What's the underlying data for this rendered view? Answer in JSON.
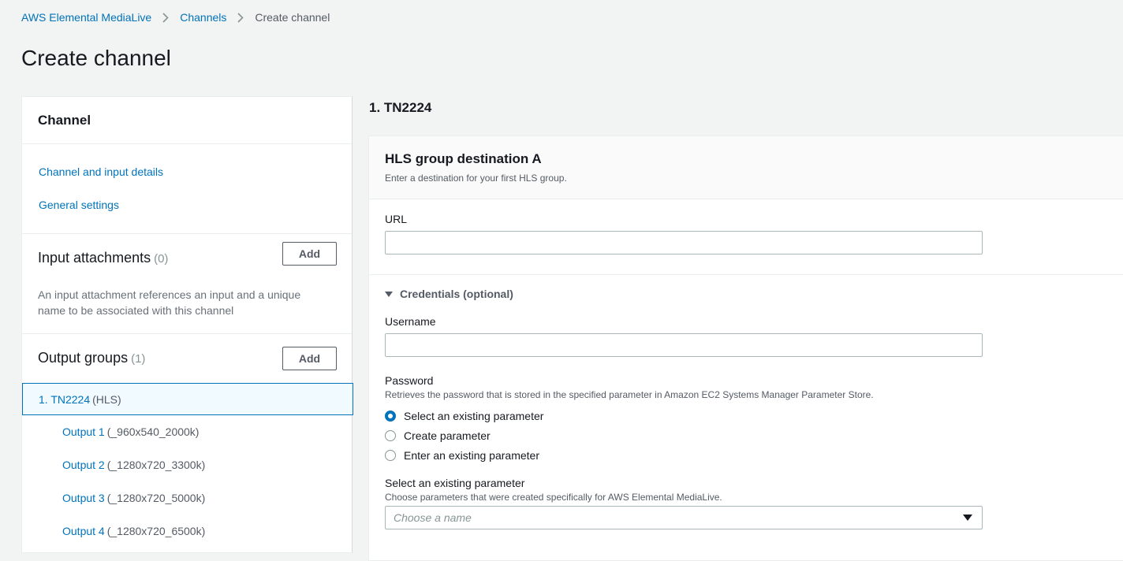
{
  "breadcrumb": {
    "items": [
      "AWS Elemental MediaLive",
      "Channels"
    ],
    "current": "Create channel"
  },
  "page": {
    "title": "Create channel"
  },
  "left_panel": {
    "header": "Channel",
    "nav_links": [
      "Channel and input details",
      "General settings"
    ],
    "input_attachments": {
      "title": "Input attachments",
      "count": "(0)",
      "add_label": "Add",
      "description": "An input attachment references an input and a unique name to be associated with this channel"
    },
    "output_groups": {
      "title": "Output groups",
      "count": "(1)",
      "add_label": "Add",
      "groups": [
        {
          "label": "1. TN2224",
          "suffix": "(HLS)"
        }
      ],
      "outputs": [
        {
          "label": "Output 1",
          "suffix": "(_960x540_2000k)"
        },
        {
          "label": "Output 2",
          "suffix": "(_1280x720_3300k)"
        },
        {
          "label": "Output 3",
          "suffix": "(_1280x720_5000k)"
        },
        {
          "label": "Output 4",
          "suffix": "(_1280x720_6500k)"
        }
      ]
    }
  },
  "right_panel": {
    "section_title": "1. TN2224",
    "destination": {
      "title": "HLS group destination A",
      "description": "Enter a destination for your first HLS group."
    },
    "url": {
      "label": "URL",
      "value": ""
    },
    "credentials": {
      "label": "Credentials (optional)",
      "username": {
        "label": "Username",
        "value": ""
      },
      "password": {
        "label": "Password",
        "description": "Retrieves the password that is stored in the specified parameter in Amazon EC2 Systems Manager Parameter Store.",
        "options": [
          "Select an existing parameter",
          "Create parameter",
          "Enter an existing parameter"
        ],
        "selected": "Select an existing parameter"
      },
      "select_parameter": {
        "label": "Select an existing parameter",
        "description": "Choose parameters that were created specifically for AWS Elemental MediaLive.",
        "placeholder": "Choose a name"
      }
    }
  },
  "colors": {
    "link": "#0073bb",
    "background": "#f2f3f3",
    "selected_border": "#0073bb"
  }
}
